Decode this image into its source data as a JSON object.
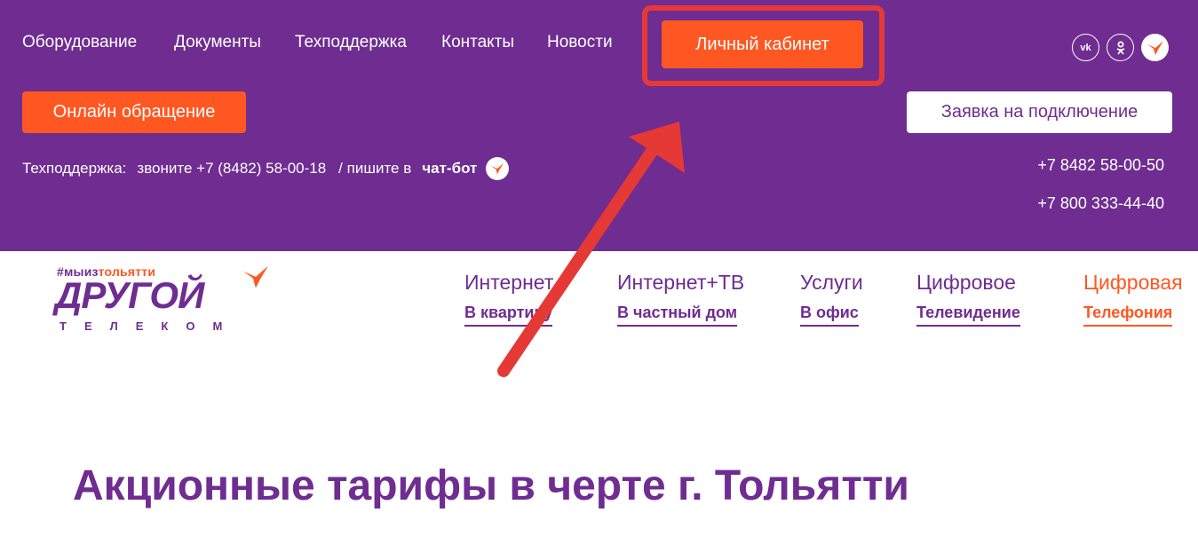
{
  "nav": {
    "items": [
      {
        "label": "Оборудование"
      },
      {
        "label": "Документы"
      },
      {
        "label": "Техподдержка"
      },
      {
        "label": "Контакты"
      },
      {
        "label": "Новости"
      }
    ],
    "cabinet_label": "Личный кабинет"
  },
  "social": {
    "vk_label": "vk",
    "ok_label": "ok",
    "icons": [
      "vk-icon",
      "odnoklassniki-icon",
      "bird-icon"
    ]
  },
  "buttons": {
    "online_request": "Онлайн обращение",
    "connect_request": "Заявка на подключение"
  },
  "support": {
    "label": "Техподдержка:",
    "call": "звоните +7 (8482) 58-00-18",
    "write": "/ пишите в",
    "chatbot": "чат-бот"
  },
  "phones": [
    "+7 8482 58-00-50",
    "+7 800 333-44-40"
  ],
  "logo": {
    "tag_prefix": "#мыиз",
    "tag_city": "тольятти",
    "main": "ДРУГОЙ",
    "sub": "ТЕЛЕКОМ"
  },
  "services": [
    {
      "title": "Интернет",
      "link": "В квартиру"
    },
    {
      "title": "Интернет+ТВ",
      "link": "В частный дом"
    },
    {
      "title": "Услуги",
      "link": "В офис"
    },
    {
      "title": "Цифровое",
      "link": "Телевидение"
    },
    {
      "title": "Цифровая",
      "link": "Телефония"
    }
  ],
  "page_title": "Акционные тарифы в черте г. Тольятти",
  "colors": {
    "purple": "#6f2c91",
    "orange": "#ff5722",
    "annotation_red": "#e53935"
  }
}
